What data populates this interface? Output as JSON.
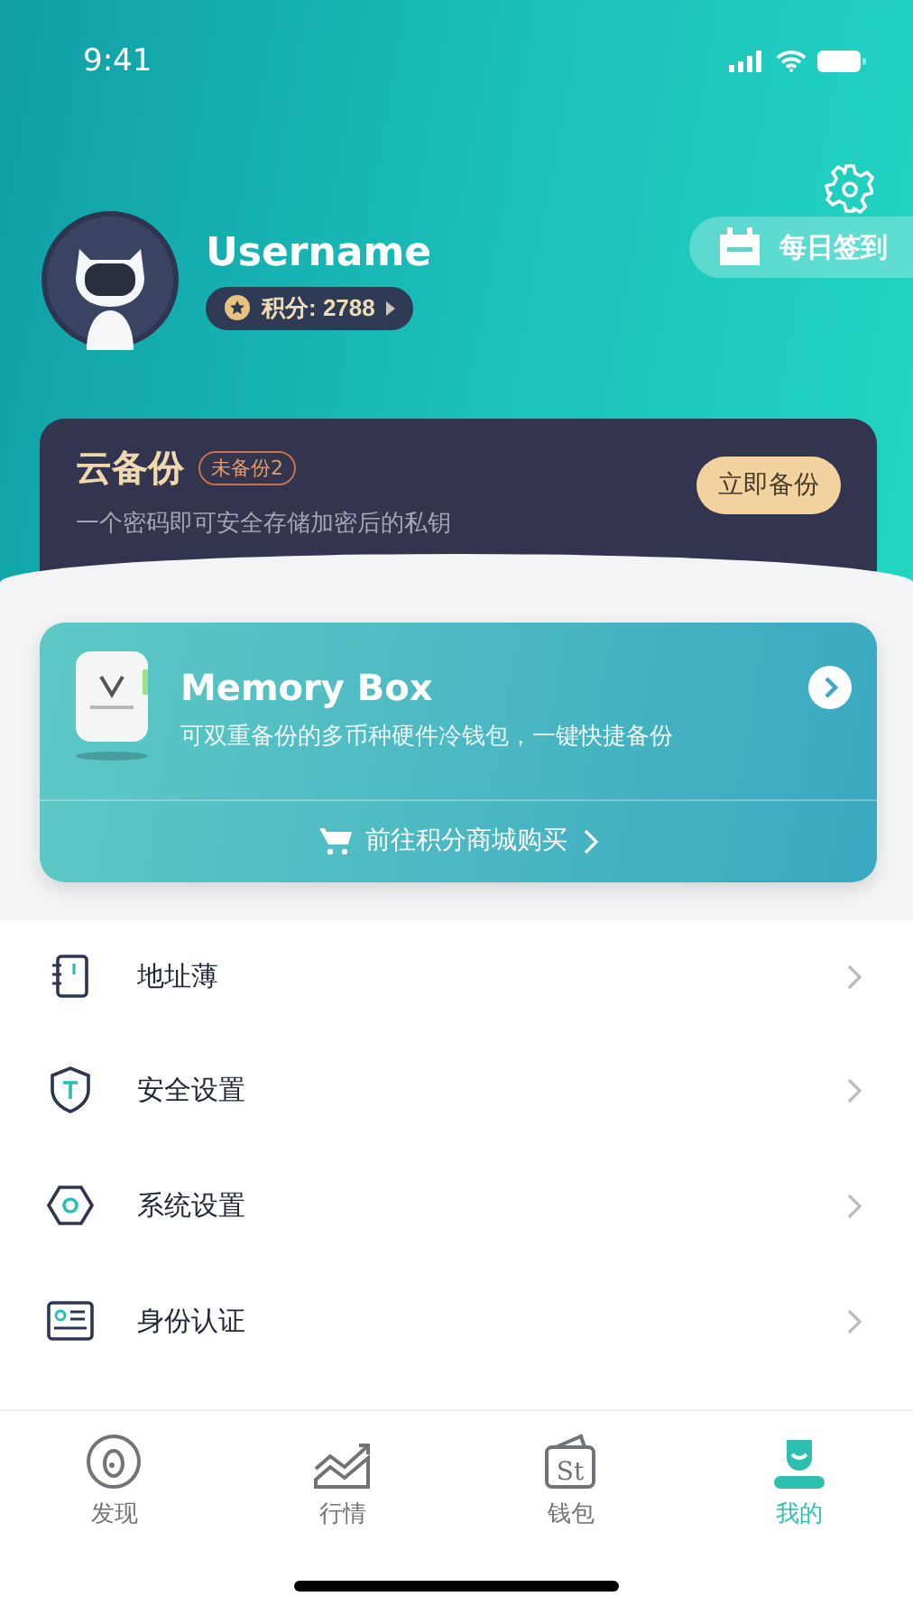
{
  "status_bar": {
    "time": "9:41"
  },
  "profile": {
    "username": "Username",
    "points": "积分: 2788",
    "checkin": "每日签到"
  },
  "cloud_backup": {
    "title": "云备份",
    "badge": "未备份2",
    "description": "一个密码即可安全存储加密后的私钥",
    "button": "立即备份"
  },
  "product": {
    "title": "Memory Box",
    "description": "可双重备份的多币种硬件冷钱包，一键快捷备份",
    "link": "前往积分商城购买"
  },
  "menu": [
    {
      "label": "地址薄",
      "kind": "book"
    },
    {
      "label": "安全设置",
      "kind": "shield"
    },
    {
      "label": "系统设置",
      "kind": "hexagon"
    },
    {
      "label": "身份认证",
      "kind": "card"
    }
  ],
  "tabs": [
    {
      "label": "发现",
      "kind": "discover",
      "selected": false
    },
    {
      "label": "行情",
      "kind": "market",
      "selected": false
    },
    {
      "label": "钱包",
      "kind": "wallet",
      "icon_text": "St",
      "selected": false
    },
    {
      "label": "我的",
      "kind": "me",
      "selected": true
    }
  ]
}
